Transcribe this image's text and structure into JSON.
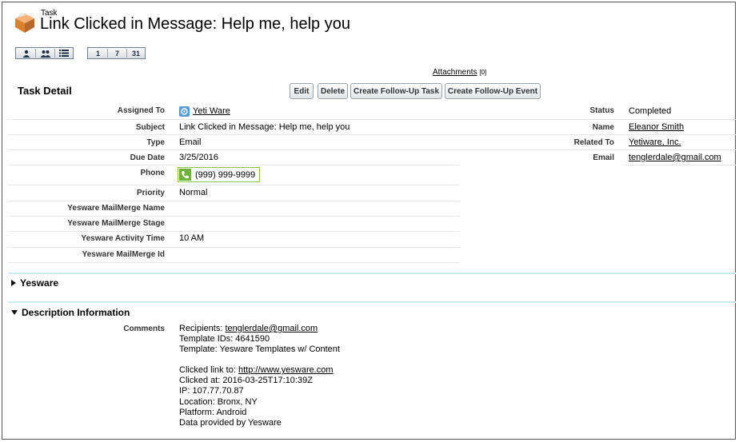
{
  "header": {
    "object_type": "Task",
    "title": "Link Clicked in Message: Help me, help you"
  },
  "toolbar": {
    "group1": [
      "user-icon",
      "users-icon",
      "list-icon"
    ],
    "group2": [
      "1",
      "7",
      "31"
    ]
  },
  "attachments": {
    "label": "Attachments",
    "count": "[0]"
  },
  "section": {
    "title": "Task Detail",
    "buttons": {
      "edit": "Edit",
      "delete": "Delete",
      "followup_task": "Create Follow-Up Task",
      "followup_event": "Create Follow-Up Event"
    }
  },
  "left": {
    "assigned_to_label": "Assigned To",
    "assigned_to": "Yeti Ware",
    "subject_label": "Subject",
    "subject": "Link Clicked in Message: Help me, help you",
    "type_label": "Type",
    "type": "Email",
    "due_label": "Due Date",
    "due": "3/25/2016",
    "phone_label": "Phone",
    "phone": "(999) 999-9999",
    "priority_label": "Priority",
    "priority": "Normal",
    "mm_name_label": "Yesware MailMerge Name",
    "mm_name": "",
    "mm_stage_label": "Yesware MailMerge Stage",
    "mm_stage": "",
    "activity_time_label": "Yesware Activity Time",
    "activity_time": "10 AM",
    "mm_id_label": "Yesware MailMerge Id",
    "mm_id": ""
  },
  "right": {
    "status_label": "Status",
    "status": "Completed",
    "name_label": "Name",
    "name": "Eleanor Smith",
    "related_label": "Related To",
    "related": "Yetiware, Inc.",
    "email_label": "Email",
    "email": "tenglerdale@gmail.com"
  },
  "yesware_section": {
    "title": "Yesware"
  },
  "description": {
    "title": "Description Information",
    "comments_label": "Comments",
    "recipients_prefix": "Recipients: ",
    "recipients_email": "tenglerdale@gmail.com",
    "template_ids": "Template IDs: 4641590",
    "template": "Template: Yesware Templates w/ Content",
    "clicked_prefix": "Clicked link to: ",
    "clicked_url": "http://www.yesware.com",
    "clicked_at": "Clicked at: 2016-03-25T17:10:39Z",
    "ip": "IP: 107.77.70.87",
    "location": "Location: Bronx, NY",
    "platform": "Platform: Android",
    "provided_by": "Data provided by Yesware"
  }
}
